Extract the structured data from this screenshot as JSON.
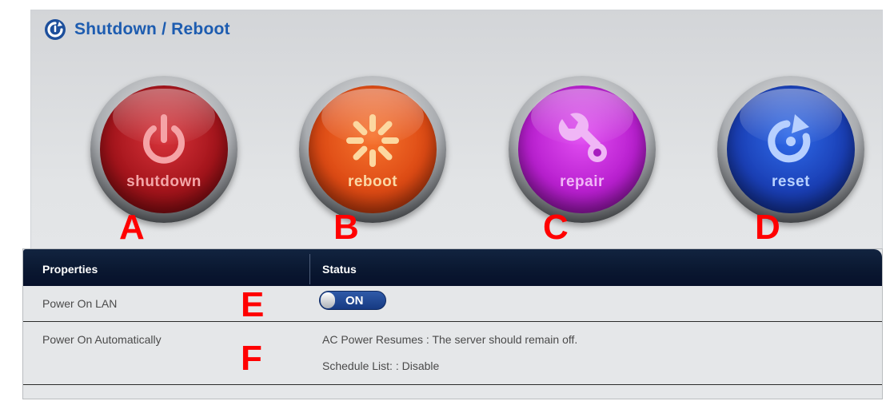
{
  "header": {
    "title": "Shutdown / Reboot"
  },
  "actions": [
    {
      "id": "shutdown",
      "label": "shutdown",
      "icon": "power-icon",
      "color": "#a3141b",
      "marker": "A"
    },
    {
      "id": "reboot",
      "label": "reboot",
      "icon": "spinner-icon",
      "color": "#dd4a14",
      "marker": "B"
    },
    {
      "id": "repair",
      "label": "repair",
      "icon": "wrench-icon",
      "color": "#b81fcf",
      "marker": "C"
    },
    {
      "id": "reset",
      "label": "reset",
      "icon": "reset-arrow-icon",
      "color": "#1a3fb5",
      "marker": "D"
    }
  ],
  "table": {
    "columns": [
      "Properties",
      "Status"
    ],
    "rows": [
      {
        "property": "Power On LAN",
        "marker": "E",
        "toggle_value": "ON"
      },
      {
        "property": "Power On Automatically",
        "marker": "F",
        "status_lines": [
          "AC Power Resumes : The server should remain off.",
          "Schedule List: : Disable"
        ]
      }
    ]
  }
}
